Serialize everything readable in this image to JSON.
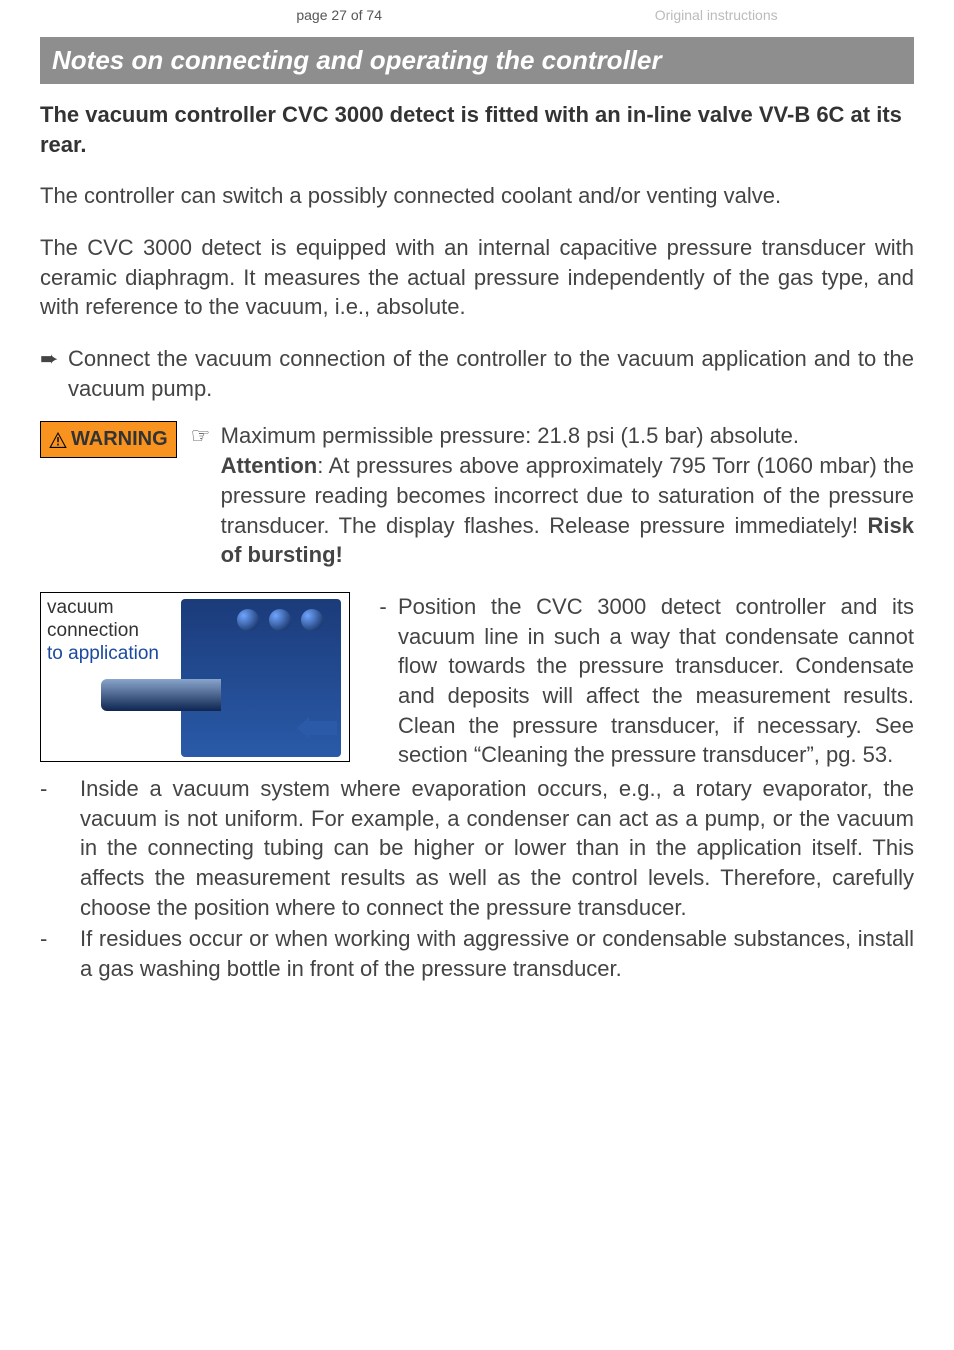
{
  "header": {
    "page_indicator": "page 27 of 74",
    "right_text": "Original instructions"
  },
  "section_title": "Notes on connecting and operating the controller",
  "bold_para": "The vacuum controller CVC 3000 detect is fitted with an in-line valve VV-B 6C at its rear.",
  "para1": "The controller can switch a possibly connected coolant and/or venting valve.",
  "para2": "The CVC 3000 detect is equipped with an internal capacitive pressure transducer with ceramic diaphragm. It measures the actual pressure independently of the gas type, and with reference to the vacuum, i.e., absolute.",
  "arrow_marker": "➨",
  "arrow_text": "Connect the vacuum connection of the controller to the vacuum application and to the vacuum pump.",
  "warning_label": "WARNING",
  "hand_marker": "☞",
  "warning_line1": "Maximum permissible pressure: 21.8 psi (1.5 bar) absolute.",
  "warning_attention_label": "Attention",
  "warning_line2_after": ": At pressures above approximately 795 Torr (1060 mbar) the pressure reading becomes incorrect due to saturation of the pressure transducer. The display flashes. Release pressure immediately! ",
  "warning_bold_tail": "Risk of bursting!",
  "figure_label_line_a": "vacuum",
  "figure_label_line_b": "connection",
  "figure_label_line_c": "to application",
  "fig_bullet": "Position the CVC 3000 detect controller and its vacuum line in such a way that condensate cannot flow towards the pressure transducer. Condensate and deposits will affect the measurement results. Clean the pressure transducer, if necessary. See section “Cleaning the pressure transducer”, pg. 53.",
  "dash_items": [
    "Inside a vacuum system where evaporation occurs, e.g., a rotary evaporator, the vacuum is not uniform. For example, a condenser can act as a pump, or the vacuum in the connecting tubing can be higher or lower than in the application itself. This affects the measurement results as well as the control levels. Therefore, carefully choose the position where to connect the pressure transducer.",
    "If residues occur or when working with aggressive or condensable substances, install a gas washing bottle in front of  the pressure transducer."
  ]
}
